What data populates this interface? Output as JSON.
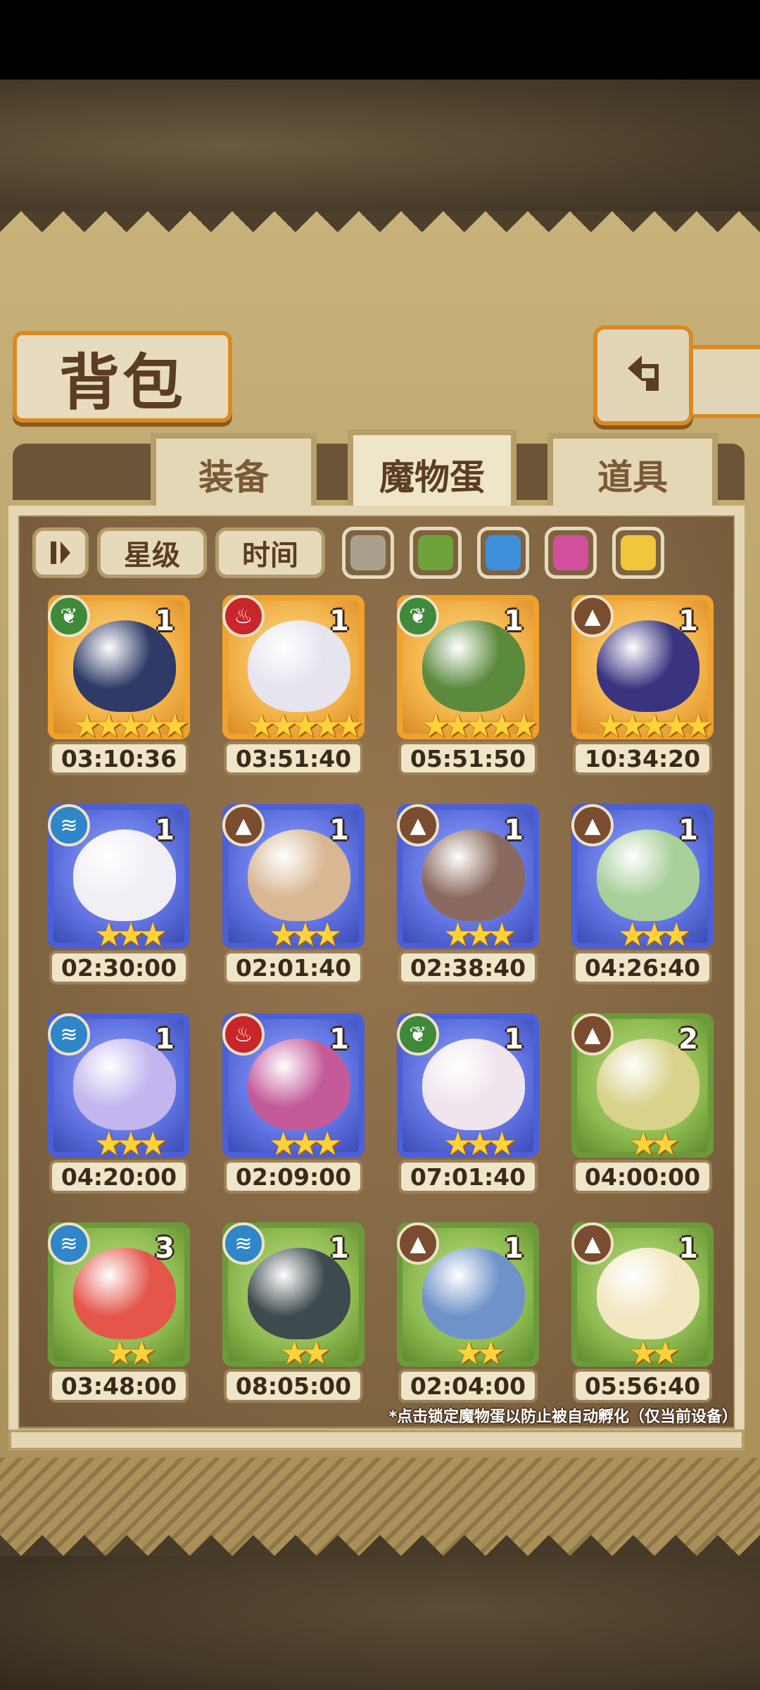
{
  "title": "背包",
  "tabs": [
    {
      "label": "装备",
      "active": false
    },
    {
      "label": "魔物蛋",
      "active": true
    },
    {
      "label": "道具",
      "active": false
    }
  ],
  "filters": {
    "sort_icon": "sort-toggle-icon",
    "star_label": "星级",
    "time_label": "时间",
    "swatches": [
      {
        "name": "gray",
        "color": "#a8a08c"
      },
      {
        "name": "green",
        "color": "#6fa23a"
      },
      {
        "name": "blue",
        "color": "#3c8fd8"
      },
      {
        "name": "pink",
        "color": "#d24f9c"
      },
      {
        "name": "gold",
        "color": "#f0c63a"
      }
    ]
  },
  "eggs": [
    {
      "count": "1",
      "element": "grass",
      "stars": 5,
      "rarity": "gold",
      "timer": "03:10:36",
      "color": "#2f3a66"
    },
    {
      "count": "1",
      "element": "fire",
      "stars": 5,
      "rarity": "gold",
      "timer": "03:51:40",
      "color": "#e6e4ef"
    },
    {
      "count": "1",
      "element": "grass",
      "stars": 5,
      "rarity": "gold",
      "timer": "05:51:50",
      "color": "#5c8a3c"
    },
    {
      "count": "1",
      "element": "earth",
      "stars": 5,
      "rarity": "gold",
      "timer": "10:34:20",
      "color": "#3a3480"
    },
    {
      "count": "1",
      "element": "water",
      "stars": 3,
      "rarity": "blue",
      "timer": "02:30:00",
      "color": "#f2eef6"
    },
    {
      "count": "1",
      "element": "earth",
      "stars": 3,
      "rarity": "blue",
      "timer": "02:01:40",
      "color": "#d9b793"
    },
    {
      "count": "1",
      "element": "earth",
      "stars": 3,
      "rarity": "blue",
      "timer": "02:38:40",
      "color": "#8a6a5e"
    },
    {
      "count": "1",
      "element": "earth",
      "stars": 3,
      "rarity": "blue",
      "timer": "04:26:40",
      "color": "#a9cf9b"
    },
    {
      "count": "1",
      "element": "water",
      "stars": 3,
      "rarity": "blue",
      "timer": "04:20:00",
      "color": "#c3b6ef"
    },
    {
      "count": "1",
      "element": "fire",
      "stars": 3,
      "rarity": "blue",
      "timer": "02:09:00",
      "color": "#c45a9a"
    },
    {
      "count": "1",
      "element": "grass",
      "stars": 3,
      "rarity": "blue",
      "timer": "07:01:40",
      "color": "#f0e4ee"
    },
    {
      "count": "2",
      "element": "earth",
      "stars": 2,
      "rarity": "green",
      "timer": "04:00:00",
      "color": "#d8d28a"
    },
    {
      "count": "3",
      "element": "water",
      "stars": 2,
      "rarity": "green",
      "timer": "03:48:00",
      "color": "#e4564a"
    },
    {
      "count": "1",
      "element": "water",
      "stars": 2,
      "rarity": "green",
      "timer": "08:05:00",
      "color": "#3e4a4e"
    },
    {
      "count": "1",
      "element": "earth",
      "stars": 2,
      "rarity": "green",
      "timer": "02:04:00",
      "color": "#6f93c9"
    },
    {
      "count": "1",
      "element": "earth",
      "stars": 2,
      "rarity": "green",
      "timer": "05:56:40",
      "color": "#f3e7c2"
    }
  ],
  "element_colors": {
    "grass": "#3f8a3a",
    "fire": "#c8262a",
    "earth": "#7a4c30",
    "water": "#2f86c8"
  },
  "element_glyphs": {
    "grass": "❦",
    "fire": "♨",
    "earth": "▲",
    "water": "≋"
  },
  "hint": "*点击锁定魔物蛋以防止被自动孵化（仅当前设备）"
}
